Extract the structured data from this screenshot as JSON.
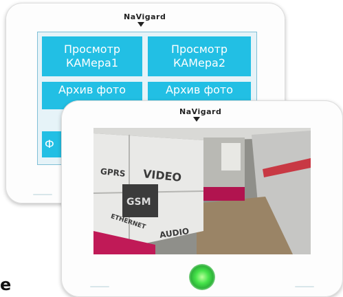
{
  "brand": {
    "logo_text": "NaVigard"
  },
  "back_device": {
    "tiles": [
      {
        "label": "Просмотр\nКАМера1"
      },
      {
        "label": "Просмотр\nКАМера2"
      },
      {
        "label": "Архив фото"
      },
      {
        "label": "Архив фото"
      },
      {
        "label": "Ф"
      }
    ]
  },
  "front_device": {
    "camera_view": {
      "labels": {
        "gprs": "GPRS",
        "video": "VIDEO",
        "gsm": "GSM",
        "ethernet": "ETHERNET",
        "audio": "AUDIO"
      }
    },
    "led_color": "#46e34a"
  },
  "stray_text": "e"
}
